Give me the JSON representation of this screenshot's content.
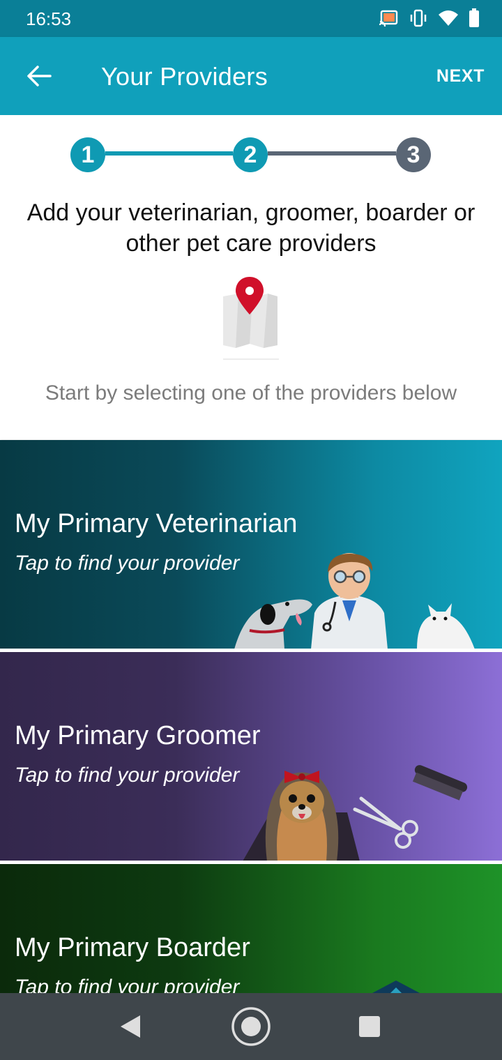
{
  "status_bar": {
    "time": "16:53",
    "icons": [
      "cast-icon",
      "vibrate-icon",
      "wifi-icon",
      "battery-icon"
    ]
  },
  "app_bar": {
    "title": "Your Providers",
    "next_label": "NEXT",
    "back_icon": "arrow-back-icon",
    "color": "#10a0bb"
  },
  "stepper": {
    "steps": [
      "1",
      "2",
      "3"
    ],
    "current_step": 2,
    "active_color": "#0f9ab3",
    "inactive_color": "#5a6675"
  },
  "intro": {
    "text": "Add your veterinarian, groomer, boarder or other pet care providers",
    "hint": "Start by selecting one of the providers below",
    "icon": "map-pin-icon"
  },
  "providers": [
    {
      "title": "My Primary Veterinarian",
      "subtitle": "Tap to find your provider",
      "color": "#10a4bf"
    },
    {
      "title": "My Primary Groomer",
      "subtitle": "Tap to find your provider",
      "color": "#8c6fd6"
    },
    {
      "title": "My Primary Boarder",
      "subtitle": "Tap to find your provider",
      "color": "#1e9228"
    }
  ],
  "nav_bar": {
    "buttons": [
      "back-triangle-icon",
      "home-circle-icon",
      "recents-square-icon"
    ]
  }
}
